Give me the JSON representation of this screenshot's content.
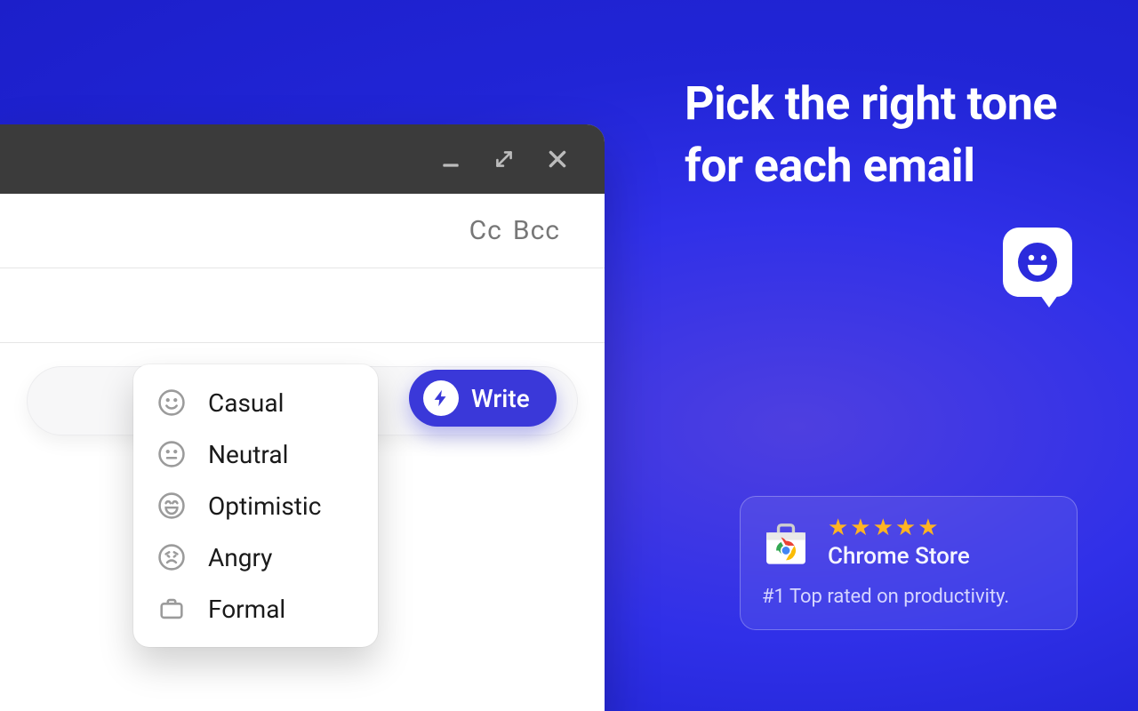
{
  "headline_text": "Pick the right tone for each email",
  "compose": {
    "cc_label": "Cc",
    "bcc_label": "Bcc"
  },
  "tone_menu": {
    "items": [
      {
        "label": "Casual",
        "icon": "smile"
      },
      {
        "label": "Neutral",
        "icon": "neutral"
      },
      {
        "label": "Optimistic",
        "icon": "grin"
      },
      {
        "label": "Angry",
        "icon": "angry"
      },
      {
        "label": "Formal",
        "icon": "briefcase"
      }
    ]
  },
  "write_button_label": "Write",
  "store_card": {
    "stars": "★★★★★",
    "title": "Chrome Store",
    "subtitle": "#1 Top rated on productivity."
  },
  "colors": {
    "accent": "#3a38d9",
    "star": "#ffb422"
  }
}
